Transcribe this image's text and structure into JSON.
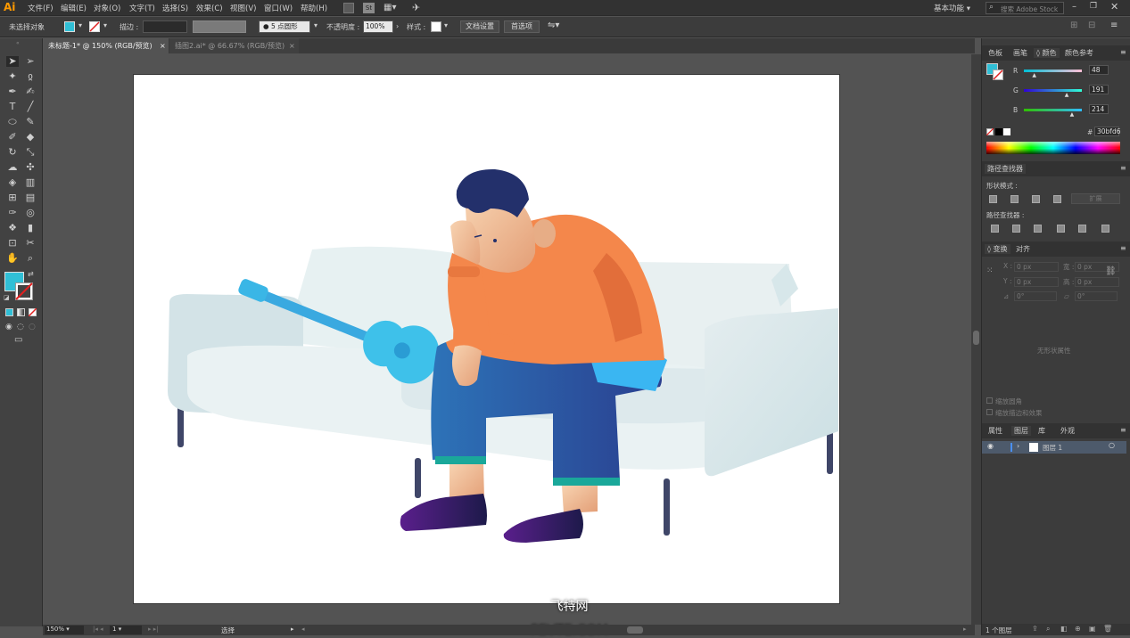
{
  "app": {
    "logo": "Ai"
  },
  "menu": [
    "文件(F)",
    "编辑(E)",
    "对象(O)",
    "文字(T)",
    "选择(S)",
    "效果(C)",
    "视图(V)",
    "窗口(W)",
    "帮助(H)"
  ],
  "workspace": {
    "label": "基本功能",
    "search_placeholder": "搜索 Adobe Stock"
  },
  "control": {
    "selection": "未选择对象",
    "stroke_label": "描边 :",
    "brush": "5 点圆形",
    "opacity_label": "不透明度 :",
    "opacity_value": "100%",
    "style_label": "样式 :",
    "doc_setup": "文档设置",
    "prefs": "首选项"
  },
  "tabs": [
    {
      "title": "未标题-1* @ 150% (RGB/预览)",
      "close": "×"
    },
    {
      "title": "插图2.ai* @ 66.67% (RGB/预览)",
      "close": "×"
    }
  ],
  "status": {
    "zoom": "150%",
    "page": "1",
    "tool": "选择"
  },
  "color_panel": {
    "tabs": [
      "色板",
      "画笔",
      "颜色",
      "颜色参考"
    ],
    "r_label": "R",
    "g_label": "G",
    "b_label": "B",
    "r": "48",
    "g": "191",
    "b": "214",
    "r_pct": 0.19,
    "g_pct": 0.75,
    "b_pct": 0.84,
    "hash": "#",
    "hex": "30bfd6",
    "fill_color": "#30bfd6"
  },
  "pathfinder": {
    "tab": "路径查找器",
    "shape_modes": "形状模式 :",
    "expand": "扩展",
    "pathfinders": "路径查找器 :"
  },
  "transform": {
    "tabs": [
      "变换",
      "对齐"
    ],
    "x_label": "X :",
    "y_label": "Y :",
    "w_label": "宽 :",
    "h_label": "高 :",
    "x": "0 px",
    "y": "0 px",
    "w": "0 px",
    "h": "0 px",
    "angle": "0°",
    "shear": "0°",
    "no_state": "无形状属性",
    "scale_corners": "缩放圆角",
    "scale_strokes": "缩放描边和效果"
  },
  "layers_panel": {
    "tabs": [
      "属性",
      "图层",
      "库",
      "外观"
    ],
    "layer_name": "图层 1",
    "count": "1 个图层"
  },
  "watermark": {
    "line1": "飞特网",
    "line2": "FEVTE.COM"
  },
  "colors": {
    "fill": "#30bfd6",
    "guitar": "#3ab6e6",
    "sweater": "#f4874b",
    "jeans": "#2f62a8",
    "sofa": "#e7eef0",
    "hair": "#23306b"
  }
}
